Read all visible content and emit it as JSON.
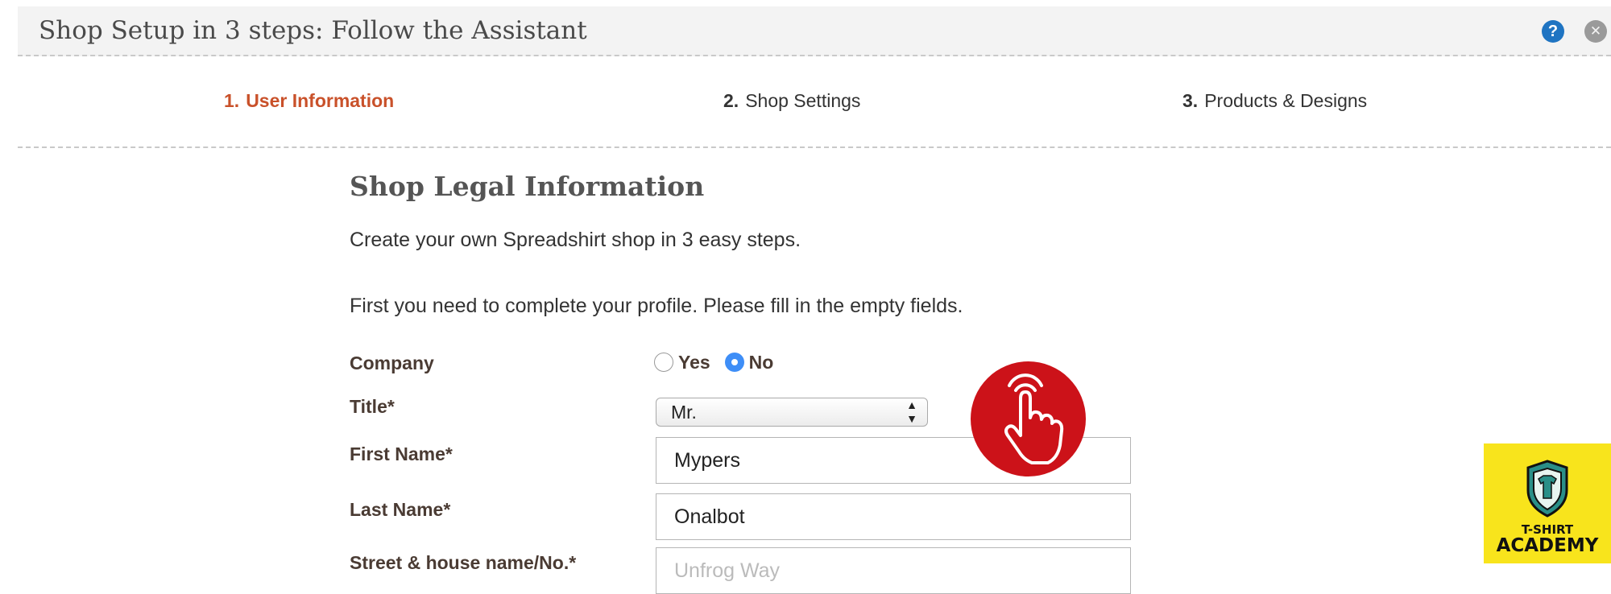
{
  "header": {
    "title": "Shop Setup in 3 steps: Follow the Assistant",
    "help_label": "?",
    "close_label": "✕"
  },
  "steps": [
    {
      "number": "1.",
      "label": "User Information",
      "active": true
    },
    {
      "number": "2.",
      "label": "Shop Settings",
      "active": false
    },
    {
      "number": "3.",
      "label": "Products & Designs",
      "active": false
    }
  ],
  "main": {
    "section_title": "Shop Legal Information",
    "intro": "Create your own Spreadshirt shop in 3 easy steps.",
    "instruction": "First you need to complete your profile. Please fill in the empty fields."
  },
  "form": {
    "company": {
      "label": "Company",
      "options": [
        "Yes",
        "No"
      ],
      "selected": "No"
    },
    "title": {
      "label": "Title*",
      "value": "Mr."
    },
    "first_name": {
      "label": "First Name*",
      "value": "Mypers"
    },
    "last_name": {
      "label": "Last Name*",
      "value": "Onalbot"
    },
    "street": {
      "label": "Street & house name/No.*",
      "value": "Unfrog Way"
    }
  },
  "badges": {
    "hand_icon": "pointing-hand-icon",
    "academy_line1": "T-SHIRT",
    "academy_line2": "ACADEMY"
  },
  "colors": {
    "active_step": "#c9512a",
    "radio_checked": "#3e8ef7",
    "hand_badge": "#cc1219",
    "academy_badge": "#f8e41c",
    "help_icon": "#1f74c2"
  }
}
